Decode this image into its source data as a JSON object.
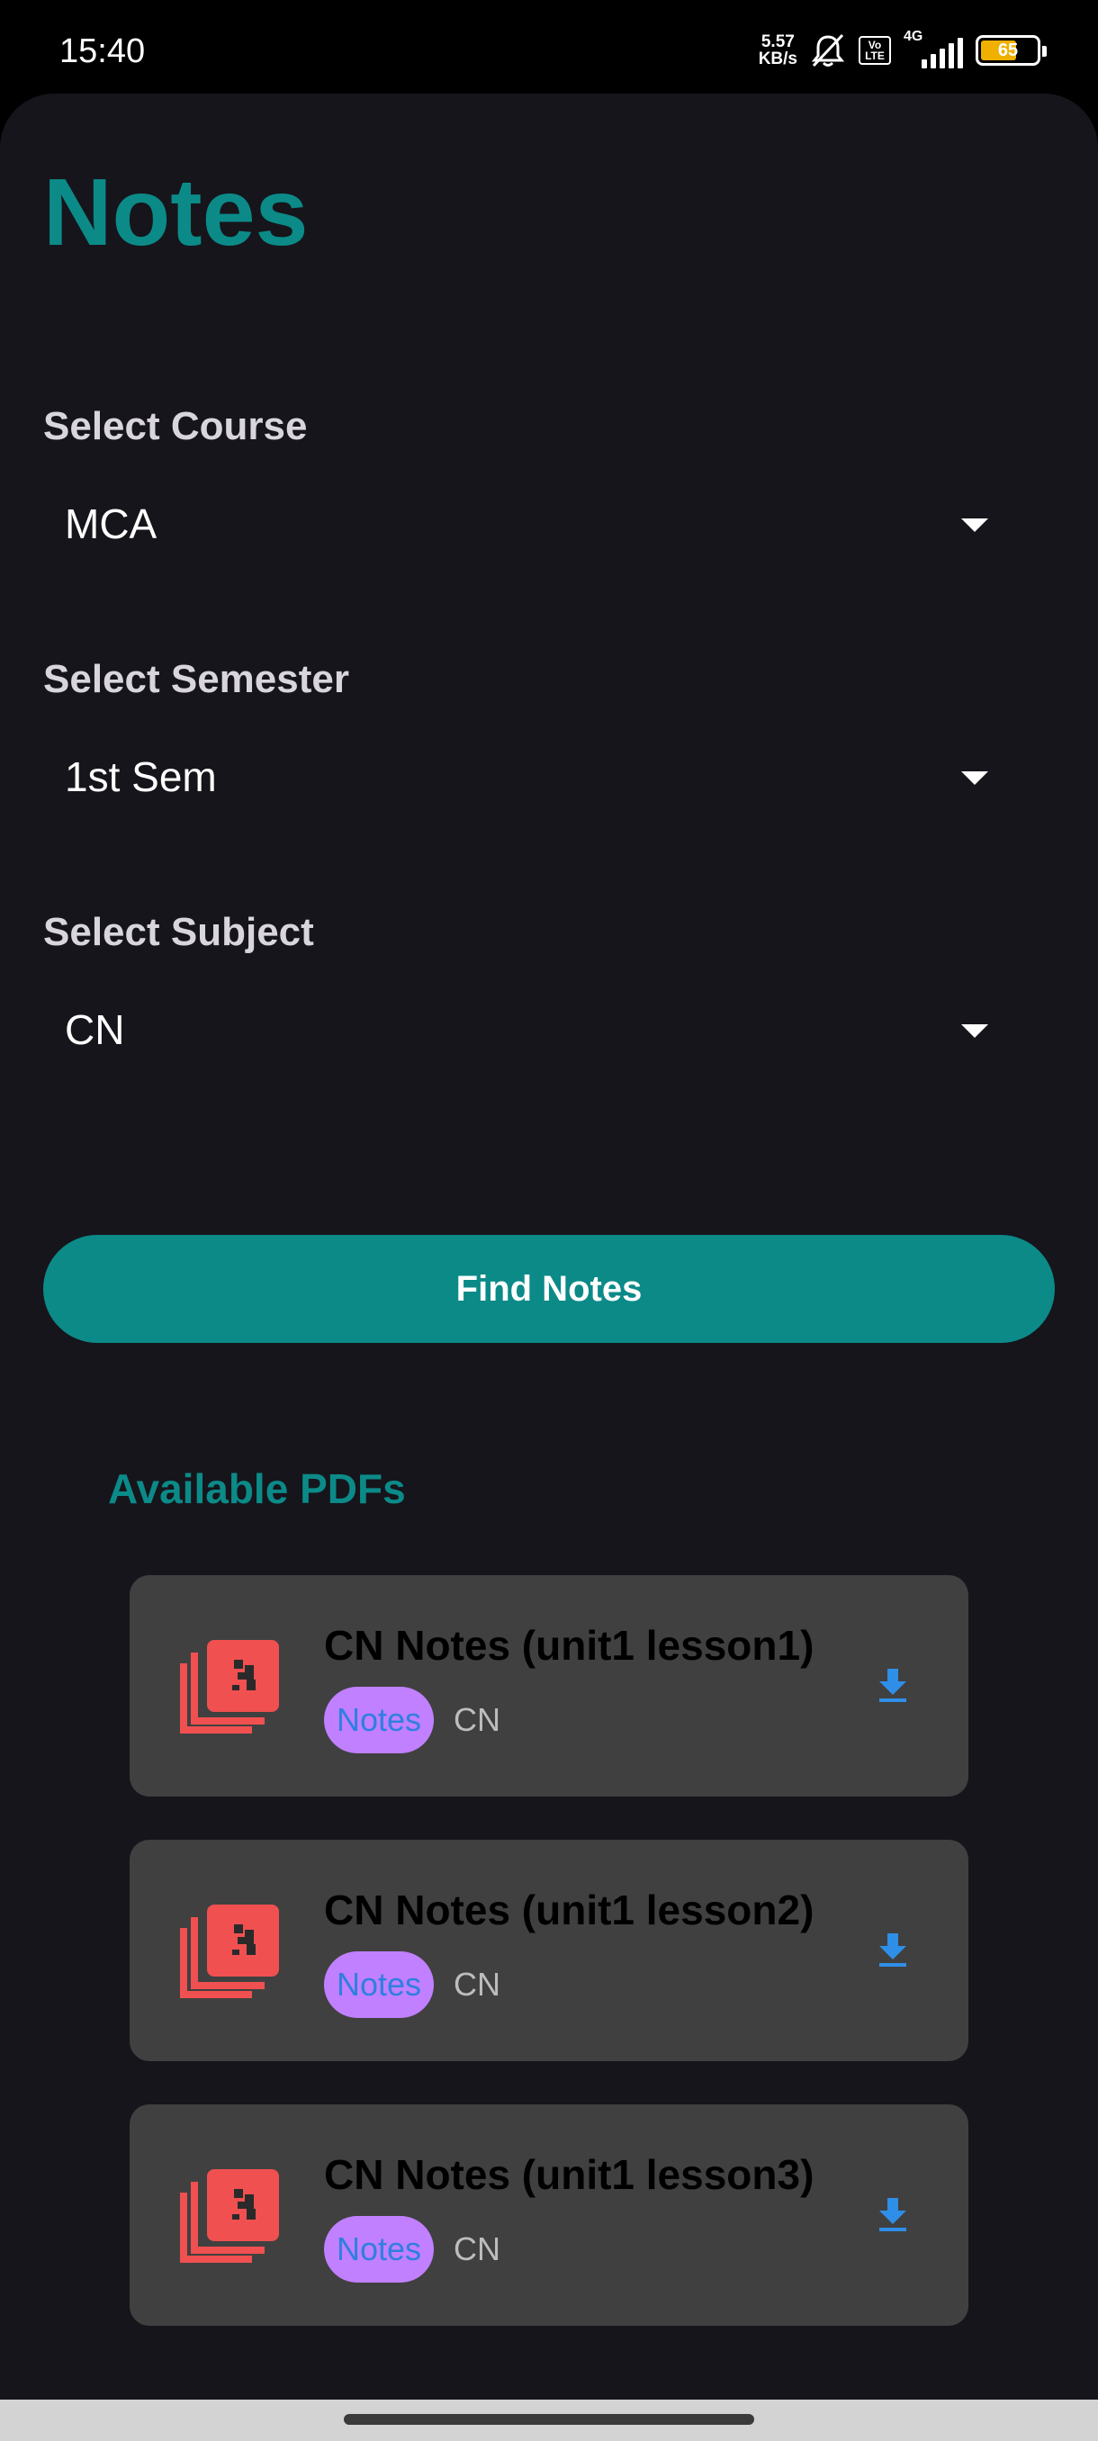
{
  "status_bar": {
    "time": "15:40",
    "net_speed_value": "5.57",
    "net_speed_unit": "KB/s",
    "volte_line1": "Vo",
    "volte_line2": "LTE",
    "network_type": "4G",
    "battery_level": 65,
    "battery_text": "65",
    "icons": [
      "mute-bell-icon",
      "volte-icon",
      "signal-icon",
      "battery-icon"
    ]
  },
  "page": {
    "title": "Notes"
  },
  "form": {
    "course": {
      "label": "Select Course",
      "value": "MCA"
    },
    "semester": {
      "label": "Select Semester",
      "value": "1st Sem"
    },
    "subject": {
      "label": "Select Subject",
      "value": "CN"
    },
    "find_button_label": "Find Notes"
  },
  "results": {
    "heading": "Available PDFs",
    "items": [
      {
        "title": "CN Notes (unit1 lesson1)",
        "tag": "Notes",
        "subject": "CN"
      },
      {
        "title": "CN Notes (unit1 lesson2)",
        "tag": "Notes",
        "subject": "CN"
      },
      {
        "title": "CN Notes (unit1 lesson3)",
        "tag": "Notes",
        "subject": "CN"
      }
    ]
  },
  "colors": {
    "accent": "#0b8a88",
    "background": "#16151b",
    "card": "#404040",
    "tag_bg": "#c080ff",
    "tag_text": "#2f7fe0",
    "pdf_icon": "#f05050",
    "download_icon": "#2f8fe8"
  }
}
